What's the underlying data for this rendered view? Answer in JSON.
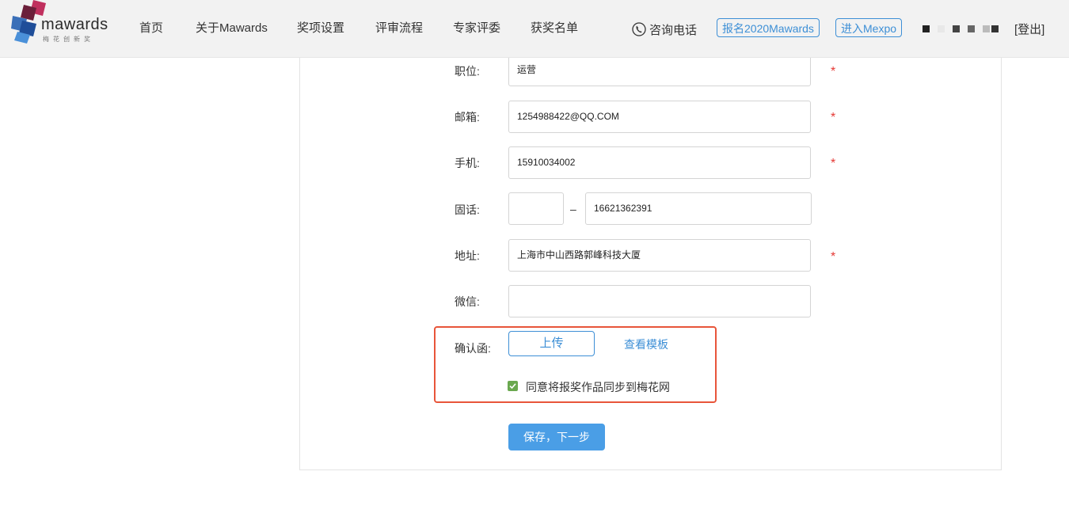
{
  "header": {
    "logo": {
      "word": "mawards",
      "sub": "梅花创新奖"
    },
    "nav": [
      "首页",
      "关于Mawards",
      "奖项设置",
      "评审流程",
      "专家评委",
      "获奖名单"
    ],
    "phone_label": "咨询电话",
    "register_button": "报名2020Mawards",
    "mexpo_button": "进入Mexpo",
    "logout": "[登出]"
  },
  "form": {
    "position": {
      "label": "职位:",
      "value": "运营"
    },
    "email": {
      "label": "邮箱:",
      "value": "1254988422@QQ.COM"
    },
    "mobile": {
      "label": "手机:",
      "value": "15910034002"
    },
    "landline": {
      "label": "固话:",
      "area_code": "",
      "separator": "–",
      "number": "16621362391"
    },
    "address": {
      "label": "地址:",
      "value": "上海市中山西路郭峰科技大厦"
    },
    "wechat": {
      "label": "微信:",
      "value": ""
    },
    "confirmation": {
      "label": "确认函:",
      "upload_button": "上传",
      "template_link": "查看模板",
      "agree_text": "同意将报奖作品同步到梅花网",
      "agree_checked": true
    },
    "required_mark": "*",
    "save_button": "保存，下一步"
  },
  "colors": {
    "accent": "#3d8fd6",
    "primary_button": "#4a9ee6",
    "required": "#e53935",
    "highlight_border": "#e8553a",
    "checkbox": "#6aa84f"
  },
  "icons": {
    "phone": "phone-icon",
    "check": "check-icon"
  }
}
